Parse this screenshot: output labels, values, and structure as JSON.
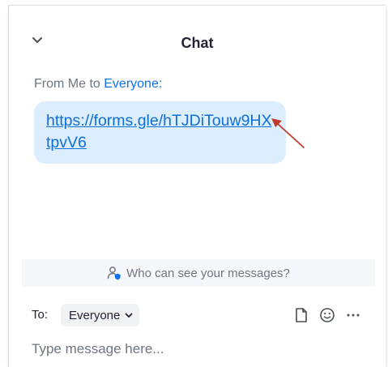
{
  "chat": {
    "title": "Chat"
  },
  "message": {
    "from": "From Me to",
    "to": "Everyone:",
    "link": "https://forms.gle/hTJDiTouw9HXtpvV6"
  },
  "visibility": {
    "label": "Who can see your messages?"
  },
  "composer": {
    "to_label": "To:",
    "recipient": "Everyone",
    "placeholder": "Type message here..."
  },
  "colors": {
    "accent": "#0e71eb",
    "bubble": "#dceefe",
    "arrow": "#c0392b"
  },
  "icons": {
    "collapse": "chevron-down-icon",
    "visibility": "person-shield-icon",
    "file": "file-icon",
    "emoji": "emoji-icon",
    "more": "more-icon"
  }
}
